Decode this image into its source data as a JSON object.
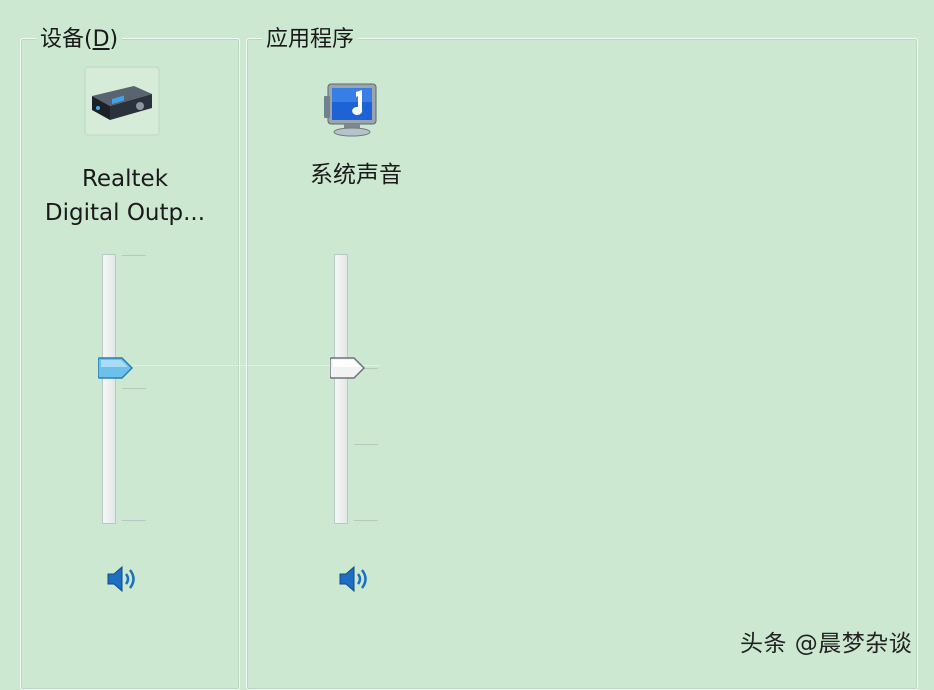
{
  "devices": {
    "title": "设备(D)",
    "title_main": "设备(",
    "title_mnemonic": "D",
    "title_close": ")",
    "name_line1": "Realtek",
    "name_line2": "Digital Outp...",
    "volume_level": 0.58,
    "icon": "speaker-receiver-icon",
    "mute_icon": "speaker-icon"
  },
  "applications": {
    "title": "应用程序",
    "items": [
      {
        "name": "系统声音",
        "volume_level": 0.58,
        "icon": "system-sounds-icon",
        "mute_icon": "speaker-icon"
      }
    ]
  },
  "watermark": "头条 @晨梦杂谈",
  "colors": {
    "background": "#cce8d0",
    "device_thumb": "#6bc1ea",
    "app_thumb": "#f2f2f2"
  }
}
